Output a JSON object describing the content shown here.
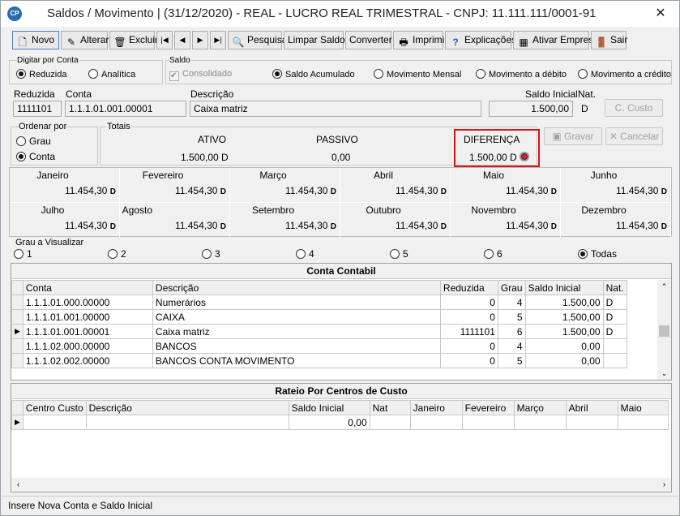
{
  "window": {
    "app_icon": "CP",
    "title": "Saldos / Movimento | (31/12/2020) - REAL - LUCRO REAL TRIMESTRAL  - CNPJ: 11.111.111/0001-91",
    "close": "✕"
  },
  "toolbar": {
    "novo": "Novo",
    "alterar": "Alterar",
    "excluir": "Excluir",
    "first": "|◀",
    "prev": "◀",
    "next": "▶",
    "last": "▶|",
    "pesquisa": "Pesquisa",
    "limpar": "Limpar Saldos",
    "converter": "Converter",
    "imprimir": "Imprimir",
    "explicacoes": "Explicações",
    "ativar": "Ativar Empresa",
    "sair": "Sair"
  },
  "digitar": {
    "label": "Digitar por Conta",
    "reduzida": "Reduzida",
    "analitica": "Analítica",
    "selected": "Reduzida"
  },
  "saldo": {
    "label": "Saldo",
    "consolidado": "Consolidado",
    "acumulado": "Saldo Acumulado",
    "mensal": "Movimento Mensal",
    "debito": "Movimento a débito",
    "credito": "Movimento a crédito",
    "selected": "Saldo Acumulado"
  },
  "fields": {
    "reduzida_label": "Reduzida",
    "reduzida_value": "1111101",
    "conta_label": "Conta",
    "conta_value": "1.1.1.01.001.00001",
    "descricao_label": "Descrição",
    "descricao_value": "Caixa matriz",
    "saldo_label": "Saldo Inicial",
    "saldo_value": "1.500,00",
    "nat_label": "Nat.",
    "nat_value": "D",
    "ccusto": "C. Custo"
  },
  "ordenar": {
    "label": "Ordenar por",
    "grau": "Grau",
    "conta": "Conta",
    "selected": "Conta"
  },
  "totais": {
    "label": "Totais",
    "ativo_label": "ATIVO",
    "ativo_value": "1.500,00 D",
    "passivo_label": "PASSIVO",
    "passivo_value": "0,00",
    "diferenca_label": "DIFERENÇA",
    "diferenca_value": "1.500,00 D"
  },
  "actions": {
    "gravar": "Gravar",
    "cancelar": "Cancelar"
  },
  "months": [
    {
      "name": "Janeiro",
      "value": "11.454,30",
      "nat": "D"
    },
    {
      "name": "Fevereiro",
      "value": "11.454,30",
      "nat": "D"
    },
    {
      "name": "Março",
      "value": "11.454,30",
      "nat": "D"
    },
    {
      "name": "Abril",
      "value": "11.454,30",
      "nat": "D"
    },
    {
      "name": "Maio",
      "value": "11.454,30",
      "nat": "D"
    },
    {
      "name": "Junho",
      "value": "11.454,30",
      "nat": "D"
    },
    {
      "name": "Julho",
      "value": "11.454,30",
      "nat": "D"
    },
    {
      "name": "Agosto",
      "value": "11.454,30",
      "nat": "D"
    },
    {
      "name": "Setembro",
      "value": "11.454,30",
      "nat": "D"
    },
    {
      "name": "Outubro",
      "value": "11.454,30",
      "nat": "D"
    },
    {
      "name": "Novembro",
      "value": "11.454,30",
      "nat": "D"
    },
    {
      "name": "Dezembro",
      "value": "11.454,30",
      "nat": "D"
    }
  ],
  "grau": {
    "label": "Grau a Visualizar",
    "options": [
      "1",
      "2",
      "3",
      "4",
      "5",
      "6",
      "Todas"
    ],
    "selected": "Todas"
  },
  "conta_grid": {
    "title": "Conta Contabil",
    "headers": [
      "Conta",
      "Descrição",
      "Reduzida",
      "Grau",
      "Saldo Inicial",
      "Nat."
    ],
    "rows": [
      [
        "1.1.1.01.000.00000",
        "Numerários",
        "0",
        "4",
        "1.500,00",
        "D"
      ],
      [
        "1.1.1.01.001.00000",
        "CAIXA",
        "0",
        "5",
        "1.500,00",
        "D"
      ],
      [
        "1.1.1.01.001.00001",
        "Caixa matriz",
        "1111101",
        "6",
        "1.500,00",
        "D"
      ],
      [
        "1.1.1.02.000.00000",
        "BANCOS",
        "0",
        "4",
        "0,00",
        ""
      ],
      [
        "1.1.1.02.002.00000",
        "BANCOS CONTA MOVIMENTO",
        "0",
        "5",
        "0,00",
        ""
      ]
    ],
    "current_row": 2
  },
  "rateio_grid": {
    "title": "Rateio Por Centros de Custo",
    "headers": [
      "Centro Custo",
      "Descrição",
      "Saldo Inicial",
      "Nat",
      "Janeiro",
      "Fevereiro",
      "Março",
      "Abril",
      "Maio"
    ],
    "rows": [
      [
        "",
        "",
        "0,00",
        "",
        "",
        "",
        "",
        "",
        ""
      ]
    ]
  },
  "status": "Insere Nova Conta e Saldo Inicial"
}
